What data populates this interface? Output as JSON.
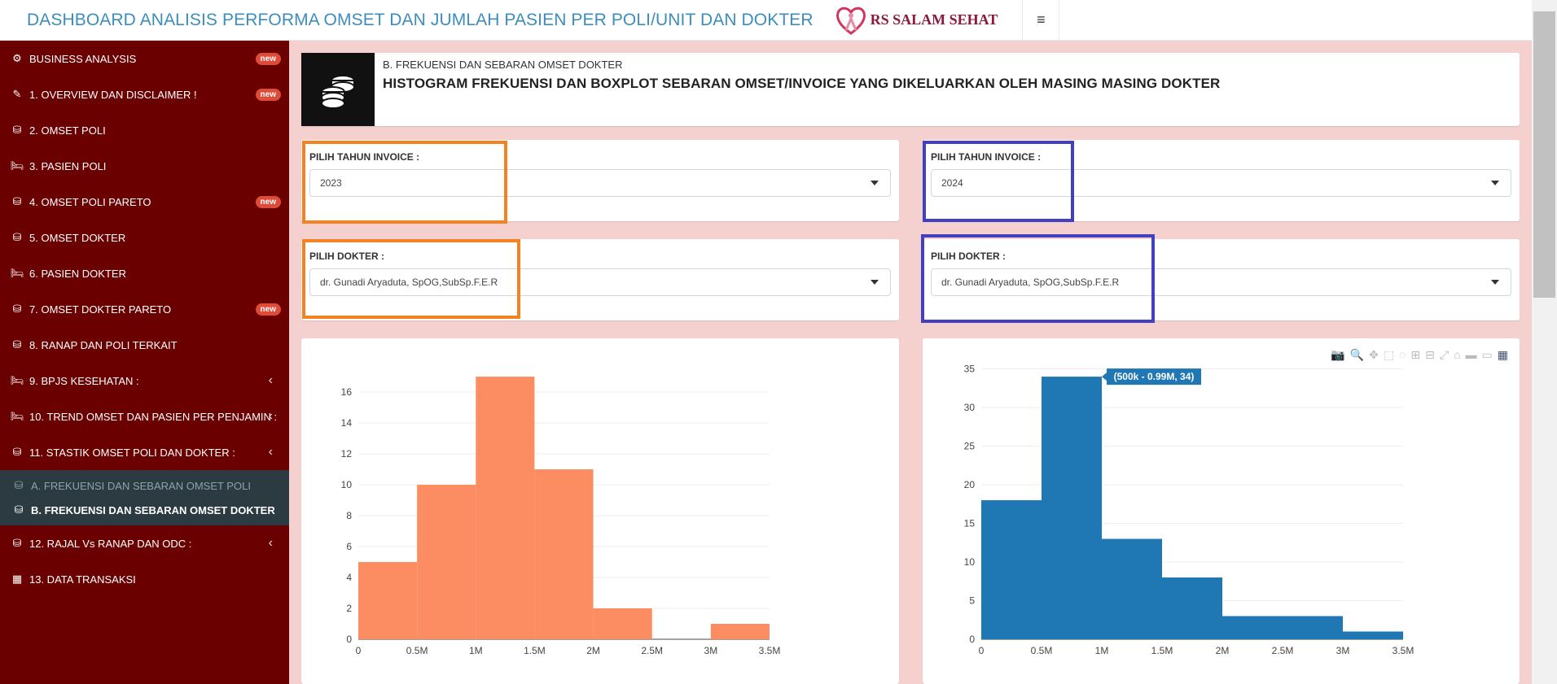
{
  "header": {
    "title": "DASHBOARD ANALISIS PERFORMA OMSET DAN JUMLAH PASIEN PER POLI/UNIT DAN DOKTER",
    "logo_text": "RS SALAM SEHAT",
    "menu_icon": "≡"
  },
  "sidebar": {
    "items": [
      {
        "label": "BUSINESS ANALYSIS",
        "icon": "gear-icon",
        "badge": "new"
      },
      {
        "label": "1. OVERVIEW DAN DISCLAIMER !",
        "icon": "pencil-icon",
        "badge": "new"
      },
      {
        "label": "2. OMSET POLI",
        "icon": "coins-icon"
      },
      {
        "label": "3. PASIEN POLI",
        "icon": "bed-icon"
      },
      {
        "label": "4. OMSET POLI PARETO",
        "icon": "coins-icon",
        "badge": "new"
      },
      {
        "label": "5. OMSET DOKTER",
        "icon": "coins-icon"
      },
      {
        "label": "6. PASIEN DOKTER",
        "icon": "bed-icon"
      },
      {
        "label": "7. OMSET DOKTER PARETO",
        "icon": "coins-icon",
        "badge": "new"
      },
      {
        "label": "8. RANAP DAN POLI TERKAIT",
        "icon": "coins-icon"
      },
      {
        "label": "9. BPJS KESEHATAN :",
        "icon": "bed-icon"
      },
      {
        "label": "10. TREND OMSET DAN PASIEN PER PENJAMIN :",
        "icon": "bed-icon"
      },
      {
        "label": "11. STASTIK OMSET POLI DAN DOKTER :",
        "icon": "coins-icon"
      },
      {
        "label": "12. RAJAL Vs RANAP DAN ODC :",
        "icon": "coins-icon"
      },
      {
        "label": "13. DATA TRANSAKSI",
        "icon": "table-icon"
      }
    ],
    "submenu": [
      {
        "label": "A. FREKUENSI DAN SEBARAN OMSET POLI"
      },
      {
        "label": "B. FREKUENSI DAN SEBARAN OMSET DOKTER"
      }
    ]
  },
  "info": {
    "subtitle": "B. FREKUENSI DAN SEBARAN OMSET DOKTER",
    "title": "HISTOGRAM FREKUENSI DAN BOXPLOT SEBARAN OMSET/INVOICE YANG DIKELUARKAN OLEH MASING MASING DOKTER"
  },
  "filters": {
    "left": {
      "year_label": "PILIH TAHUN INVOICE :",
      "year_value": "2023",
      "doctor_label": "PILIH DOKTER :",
      "doctor_value": "dr. Gunadi Aryaduta, SpOG,SubSp.F.E.R"
    },
    "right": {
      "year_label": "PILIH TAHUN INVOICE :",
      "year_value": "2024",
      "doctor_label": "PILIH DOKTER :",
      "doctor_value": "dr. Gunadi Aryaduta, SpOG,SubSp.F.E.R"
    }
  },
  "colors": {
    "sidebar_bg": "#6b0000",
    "left_highlight": "#f58220",
    "right_highlight": "#4040c0",
    "left_bars": "#fc8d62",
    "right_bars": "#1f77b4"
  },
  "chart_data": [
    {
      "type": "bar",
      "x_edges": [
        0,
        0.5,
        1,
        1.5,
        2,
        2.5,
        3,
        3.5
      ],
      "values": [
        5,
        10,
        17,
        11,
        2,
        0,
        1
      ],
      "x_tick_labels": [
        "0",
        "0.5M",
        "1M",
        "1.5M",
        "2M",
        "2.5M",
        "3M",
        "3.5M"
      ],
      "y_ticks": [
        0,
        2,
        4,
        6,
        8,
        10,
        12,
        14,
        16
      ],
      "ylim": [
        0,
        17.9
      ],
      "color": "#fc8d62",
      "grid": true
    },
    {
      "type": "bar",
      "x_edges": [
        0,
        0.5,
        1,
        1.5,
        2,
        2.5,
        3,
        3.5
      ],
      "values": [
        18,
        34,
        13,
        8,
        3,
        3,
        1
      ],
      "x_tick_labels": [
        "0",
        "0.5M",
        "1M",
        "1.5M",
        "2M",
        "2.5M",
        "3M",
        "3.5M"
      ],
      "y_ticks": [
        0,
        5,
        10,
        15,
        20,
        25,
        30,
        35
      ],
      "ylim": [
        0,
        35.8
      ],
      "color": "#1f77b4",
      "grid": true,
      "hover_label": "(500k - 0.99M, 34)",
      "hover_bin": 1
    }
  ]
}
